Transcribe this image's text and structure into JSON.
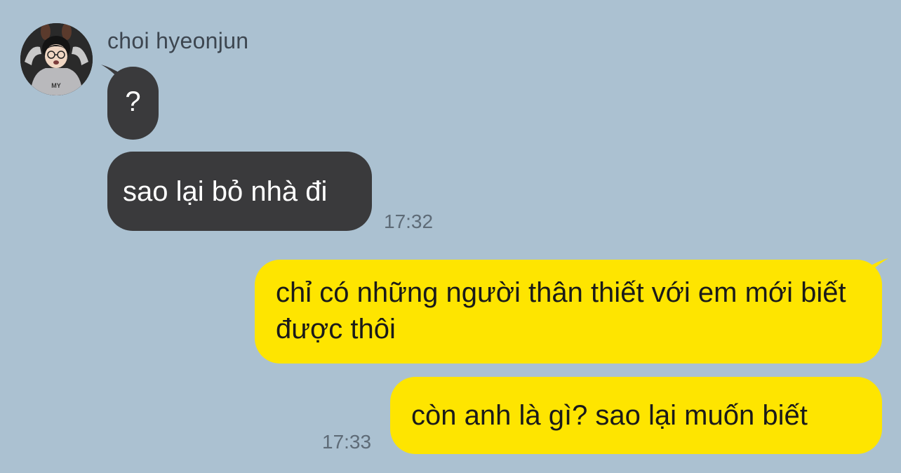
{
  "theme": {
    "background": "#abc1d1",
    "incoming_bubble": "#3a3a3c",
    "outgoing_bubble": "#fee500"
  },
  "contact": {
    "name": "choi hyeonjun",
    "avatar_icon": "profile-photo"
  },
  "messages": [
    {
      "direction": "incoming",
      "text": "?"
    },
    {
      "direction": "incoming",
      "text": "sao lại bỏ nhà đi",
      "time": "17:32"
    },
    {
      "direction": "outgoing",
      "text": "chỉ có những người thân thiết với em mới biết được thôi"
    },
    {
      "direction": "outgoing",
      "text": "còn anh là gì? sao lại muốn biết",
      "time": "17:33"
    }
  ]
}
